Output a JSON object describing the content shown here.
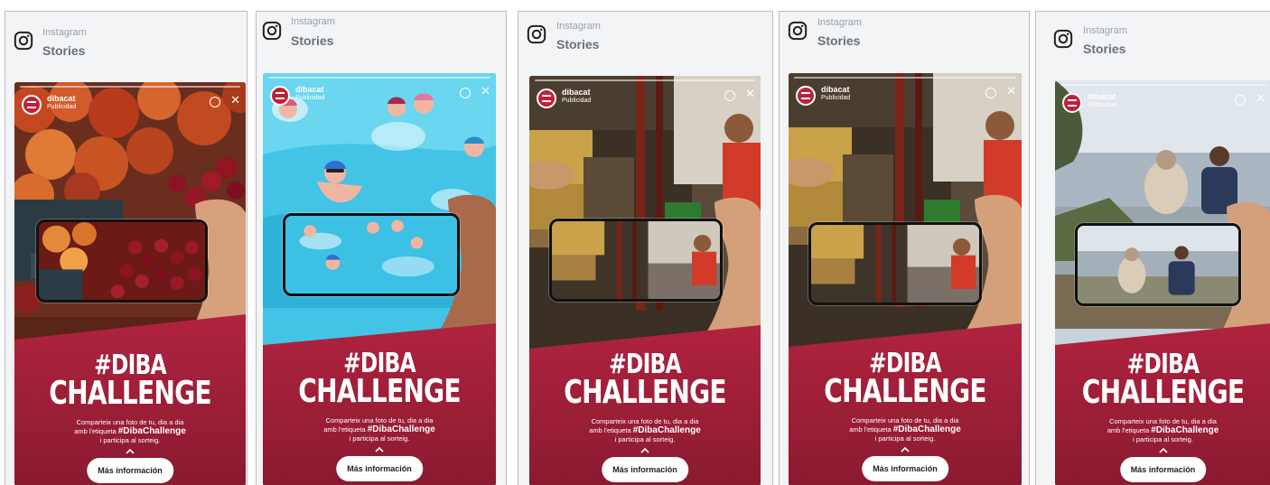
{
  "colors": {
    "brand_red": "#b0233f",
    "panel_bg": "#f3f4f6",
    "header_text": "#6b7079"
  },
  "panels": [
    {
      "platform": "Instagram",
      "placement": "Stories",
      "account": "dibacat",
      "sponsored": "Publicidad",
      "headline_1": "#DIBA",
      "headline_2": "CHALLENGE",
      "caption_line_1": "Comparteix una foto de tu, dia a dia",
      "caption_pre": "amb l'etiqueta ",
      "caption_tag": "#DibaChallenge",
      "caption_line_3": "i participa al sorteig.",
      "cta": "Más información",
      "scene": "market-tomatoes"
    },
    {
      "platform": "Instagram",
      "placement": "Stories",
      "account": "dibacat",
      "sponsored": "Publicidad",
      "headline_1": "#DIBA",
      "headline_2": "CHALLENGE",
      "caption_line_1": "Comparteix una foto de tu, dia a dia",
      "caption_pre": "amb l'etiqueta ",
      "caption_tag": "#DibaChallenge",
      "caption_line_3": "i participa al sorteig.",
      "cta": "Más información",
      "scene": "swimming-pool"
    },
    {
      "platform": "Instagram",
      "placement": "Stories",
      "account": "dibacat",
      "sponsored": "Publicidad",
      "headline_1": "#DIBA",
      "headline_2": "CHALLENGE",
      "caption_line_1": "Comparteix una foto de tu, dia a dia",
      "caption_pre": "amb l'etiqueta ",
      "caption_tag": "#DibaChallenge",
      "caption_line_3": "i participa al sorteig.",
      "cta": "Más información",
      "scene": "library-reading"
    },
    {
      "platform": "Instagram",
      "placement": "Stories",
      "account": "dibacat",
      "sponsored": "Publicidad",
      "headline_1": "#DIBA",
      "headline_2": "CHALLENGE",
      "caption_line_1": "Comparteix una foto de tu, dia a dia",
      "caption_pre": "amb l'etiqueta ",
      "caption_tag": "#DibaChallenge",
      "caption_line_3": "i participa al sorteig.",
      "cta": "Más información",
      "scene": "library-reading"
    },
    {
      "platform": "Instagram",
      "placement": "Stories",
      "account": "dibacat",
      "sponsored": "Publicidad",
      "headline_1": "#DIBA",
      "headline_2": "CHALLENGE",
      "caption_line_1": "Comparteix una foto de tu, dia a dia",
      "caption_pre": "amb l'etiqueta ",
      "caption_tag": "#DibaChallenge",
      "caption_line_3": "i participa al sorteig.",
      "cta": "Más información",
      "scene": "city-viewpoint"
    }
  ]
}
